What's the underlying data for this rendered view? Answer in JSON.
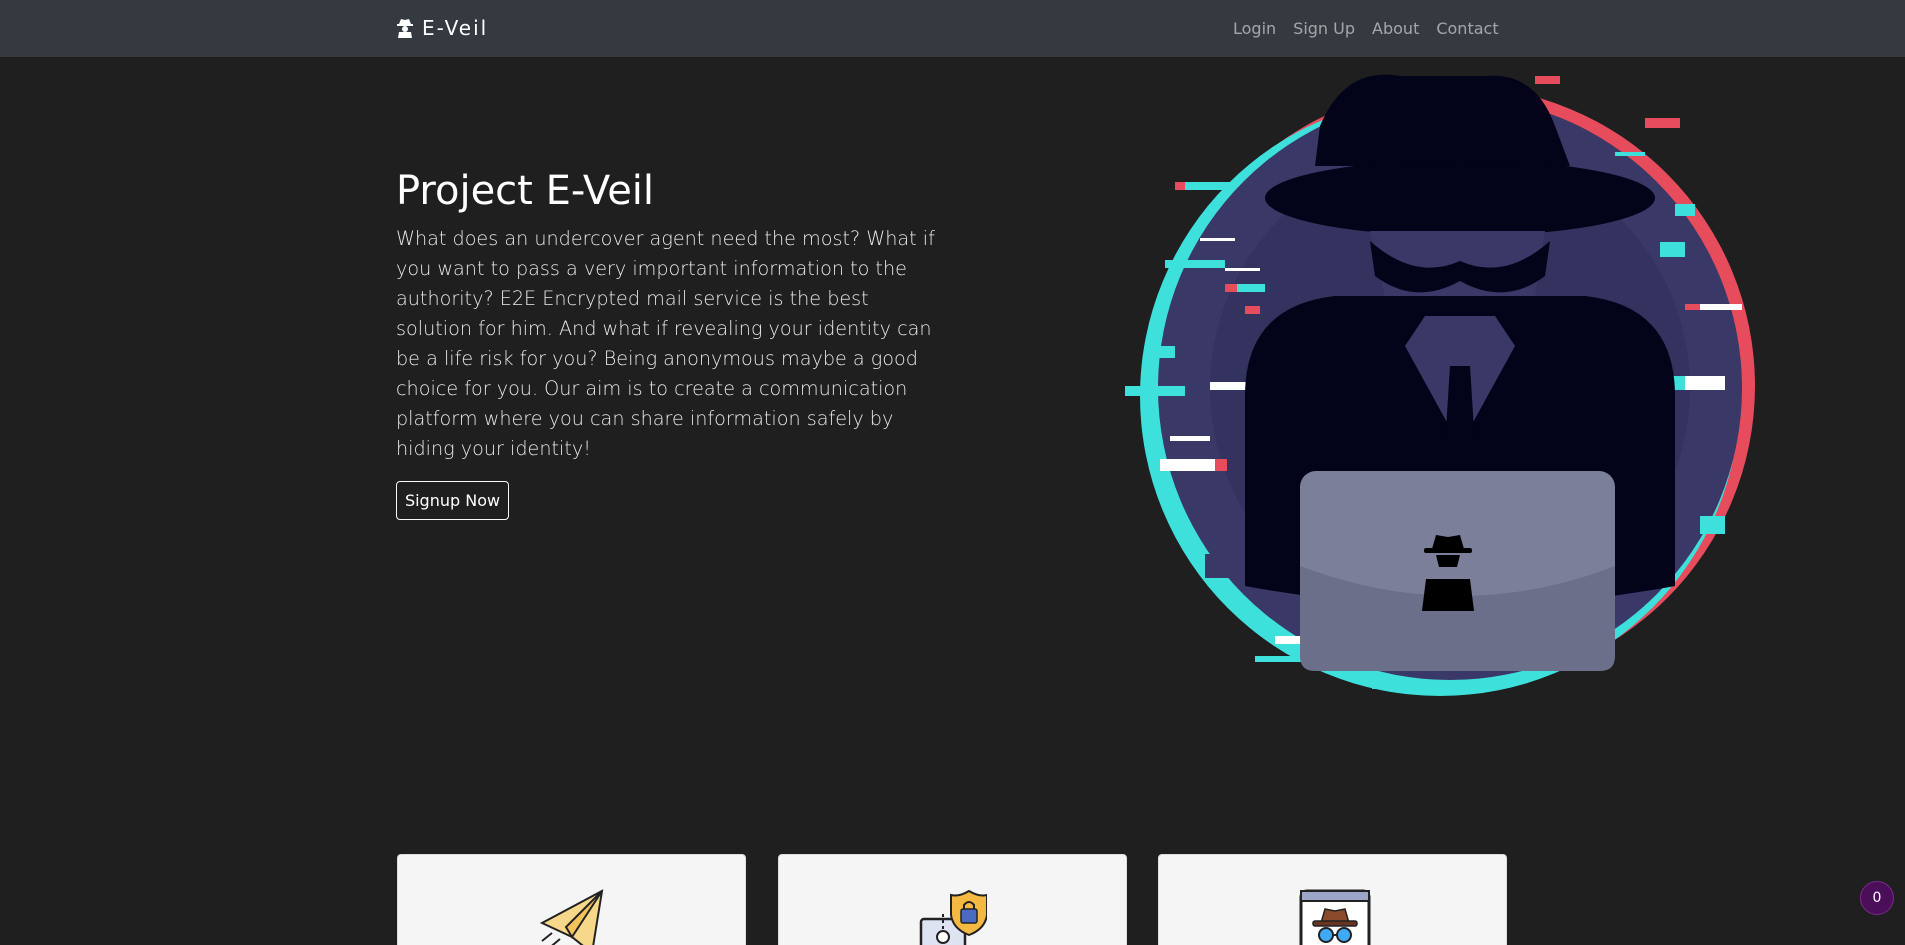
{
  "navbar": {
    "brand": "E-Veil",
    "links": [
      "Login",
      "Sign Up",
      "About",
      "Contact"
    ]
  },
  "hero": {
    "title": "Project E-Veil",
    "description": "What does an undercover agent need the most? What if you want to pass a very important information to the authority? E2E Encrypted mail service is the best solution for him. And what if revealing your identity can be a life risk for you? Being anonymous maybe a good choice for you. Our aim is to create a communication platform where you can share information safely by hiding your identity!",
    "cta_label": "Signup Now"
  },
  "cards": [
    {
      "icon": "paper-plane-icon"
    },
    {
      "icon": "key-lock-shield-icon"
    },
    {
      "icon": "incognito-browser-icon"
    }
  ],
  "badge": {
    "count": "0"
  },
  "colors": {
    "navbar_bg": "#343a40",
    "page_bg": "#1f1f1f",
    "glitch_red": "#e74c5c",
    "glitch_cyan": "#3ee0dc",
    "circle_purple": "#3a3866",
    "badge_purple": "#4b0f5a"
  }
}
